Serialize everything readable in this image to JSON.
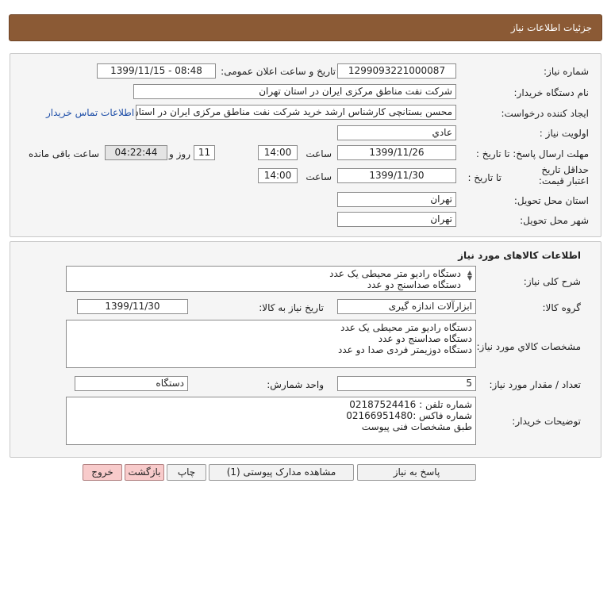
{
  "header": {
    "title": "جزئیات اطلاعات نیاز"
  },
  "general": {
    "need_number_label": "شماره نیاز:",
    "need_number": "1299093221000087",
    "announce_label": "تاریخ و ساعت اعلان عمومی:",
    "announce_value": "1399/11/15 - 08:48",
    "buyer_label": "نام دستگاه خریدار:",
    "buyer_value": "شرکت نفت مناطق مرکزی ایران در استان تهران",
    "requester_label": "ایجاد کننده درخواست:",
    "requester_value": "محسن بستانچی کارشناس ارشد خرید شرکت نفت مناطق مرکزی ایران در استان تهران",
    "contact_link": "اطلاعات تماس خریدار",
    "priority_label": "اولویت نیاز :",
    "priority_value": "عادي",
    "deadline_label": "مهلت ارسال پاسخ: تا تاریخ :",
    "deadline_date": "1399/11/26",
    "time_label": "ساعت",
    "deadline_time": "14:00",
    "days_value": "11",
    "days_label": "روز و",
    "remaining_time": "04:22:44",
    "remaining_label": "ساعت باقی مانده",
    "validity_label": "حداقل تاریخ اعتبار قیمت:",
    "validity_to_label": "تا تاریخ :",
    "validity_date": "1399/11/30",
    "validity_time": "14:00",
    "province_label": "استان محل تحویل:",
    "province_value": "تهران",
    "city_label": "شهر محل تحویل:",
    "city_value": "تهران"
  },
  "goods": {
    "section_title": "اطلاعات کالاهای مورد نیاز",
    "desc_label": "شرح کلی نیاز:",
    "desc_lines": [
      "دستگاه رادیو متر محیطی یک عدد",
      "دستگاه صداسنج دو عدد"
    ],
    "group_label": "گروه کالا:",
    "group_value": "ابزارآلات اندازه گیری",
    "need_date_label": "تاریخ نیاز به کالا:",
    "need_date_value": "1399/11/30",
    "specs_label": "مشخصات کالاي مورد نیاز:",
    "specs_lines": [
      "دستگاه رادیو متر محیطی یک عدد",
      "دستگاه صداسنج دو عدد",
      "دستگاه دوزیمتر فردی صدا دو عدد"
    ],
    "qty_label": "تعداد / مقدار مورد نیاز:",
    "qty_value": "5",
    "unit_label": "واحد شمارش:",
    "unit_value": "دستگاه",
    "notes_label": "توضیحات خریدار:",
    "notes_lines": [
      "شماره تلفن : 02187524416",
      "شماره فاکس :02166951480",
      "طبق مشخصات فنی پیوست"
    ]
  },
  "buttons": {
    "reply": "پاسخ به نیاز",
    "attachments": "مشاهده مدارک پیوستی (1)",
    "print": "چاپ",
    "back": "بازگشت",
    "exit": "خروج"
  }
}
